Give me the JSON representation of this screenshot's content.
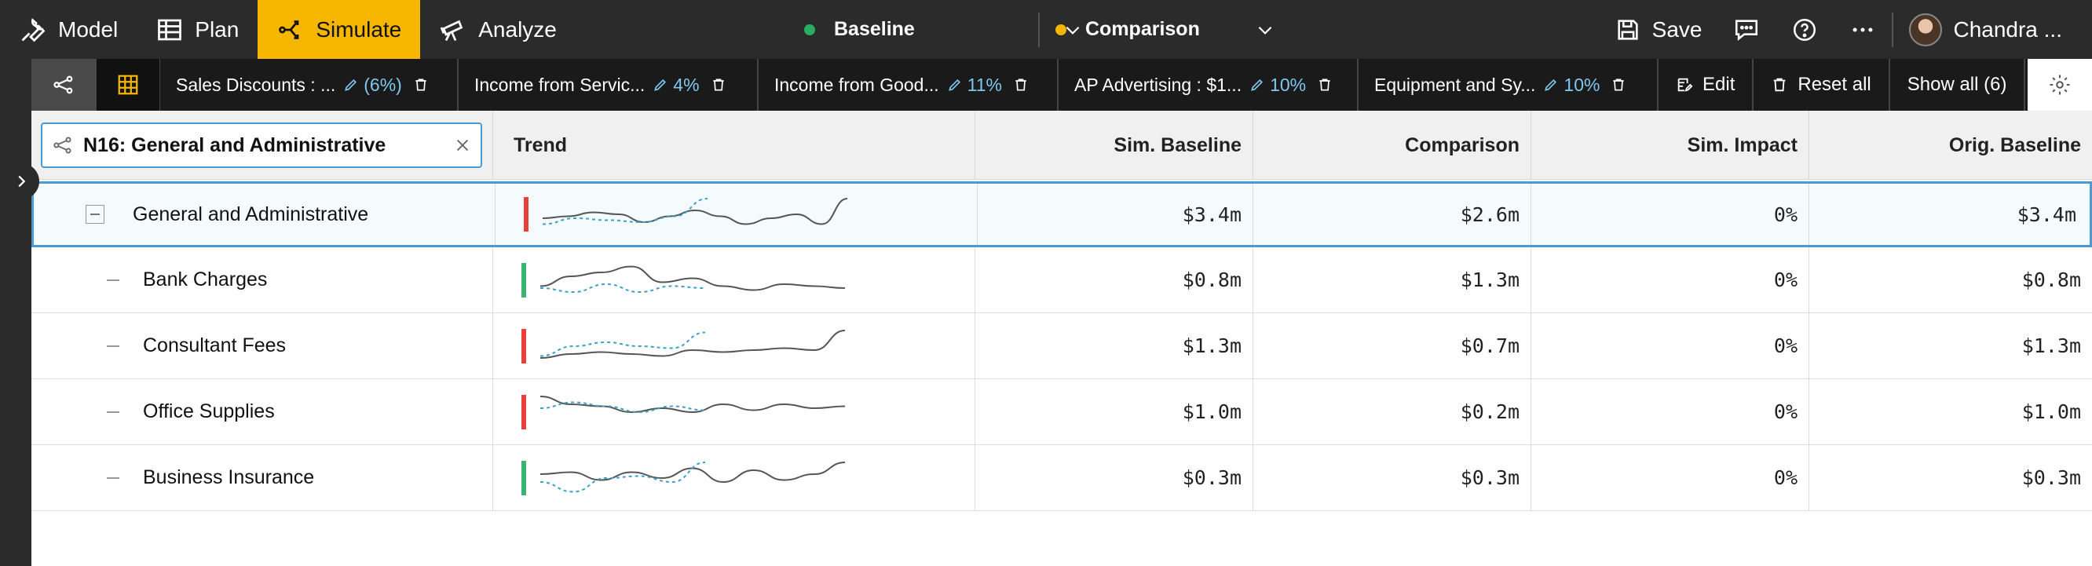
{
  "nav": {
    "model": "Model",
    "plan": "Plan",
    "simulate": "Simulate",
    "analyze": "Analyze"
  },
  "scenarios": {
    "baseline": {
      "label": "Baseline",
      "color": "#27ae60"
    },
    "comparison": {
      "label": "Comparison",
      "color": "#f6b600"
    }
  },
  "tools": {
    "save": "Save",
    "user": "Chandra ..."
  },
  "chips": [
    {
      "label": "Sales Discounts : ...",
      "pct": "(6%)"
    },
    {
      "label": "Income from Servic...",
      "pct": "4%"
    },
    {
      "label": "Income from Good...",
      "pct": "11%"
    },
    {
      "label": "AP Advertising : $1...",
      "pct": "10%"
    },
    {
      "label": "Equipment and Sy...",
      "pct": "10%"
    }
  ],
  "actions": {
    "edit": "Edit",
    "reset": "Reset all",
    "show_all": "Show all (6)"
  },
  "table": {
    "search_value": "N16: General and Administrative",
    "headers": {
      "trend": "Trend",
      "sim_baseline": "Sim. Baseline",
      "comparison": "Comparison",
      "sim_impact": "Sim. Impact",
      "orig_baseline": "Orig. Baseline"
    },
    "rows": [
      {
        "name": "General and Administrative",
        "bar_color": "#e8413c",
        "sim_baseline": "$3.4m",
        "comparison": "$2.6m",
        "sim_impact": "0%",
        "orig_baseline": "$3.4m",
        "selected": true,
        "parent": true,
        "solid": [
          0.6,
          0.55,
          0.45,
          0.5,
          0.7,
          0.55,
          0.4,
          0.55,
          0.75,
          0.6,
          0.5,
          0.75,
          0.1
        ],
        "dotted": [
          0.75,
          0.6,
          0.65,
          0.7,
          0.55,
          0.1
        ]
      },
      {
        "name": "Bank Charges",
        "bar_color": "#3cb371",
        "sim_baseline": "$0.8m",
        "comparison": "$1.3m",
        "sim_impact": "0%",
        "orig_baseline": "$0.8m",
        "selected": false,
        "parent": false,
        "solid": [
          0.65,
          0.4,
          0.3,
          0.15,
          0.55,
          0.45,
          0.65,
          0.75,
          0.6,
          0.65,
          0.7
        ],
        "dotted": [
          0.7,
          0.8,
          0.6,
          0.8,
          0.65,
          0.7
        ]
      },
      {
        "name": "Consultant Fees",
        "bar_color": "#e8413c",
        "sim_baseline": "$1.3m",
        "comparison": "$0.7m",
        "sim_impact": "0%",
        "orig_baseline": "$1.3m",
        "selected": false,
        "parent": false,
        "solid": [
          0.8,
          0.7,
          0.65,
          0.7,
          0.75,
          0.6,
          0.65,
          0.6,
          0.55,
          0.6,
          0.1
        ],
        "dotted": [
          0.75,
          0.5,
          0.4,
          0.5,
          0.55,
          0.15
        ]
      },
      {
        "name": "Office Supplies",
        "bar_color": "#e8413c",
        "sim_baseline": "$1.0m",
        "comparison": "$0.2m",
        "sim_impact": "0%",
        "orig_baseline": "$1.0m",
        "selected": false,
        "parent": false,
        "solid": [
          0.1,
          0.3,
          0.35,
          0.5,
          0.4,
          0.5,
          0.3,
          0.45,
          0.3,
          0.4,
          0.35
        ],
        "dotted": [
          0.4,
          0.25,
          0.35,
          0.5,
          0.35,
          0.45
        ]
      },
      {
        "name": "Business Insurance",
        "bar_color": "#3cb371",
        "sim_baseline": "$0.3m",
        "comparison": "$0.3m",
        "sim_impact": "0%",
        "orig_baseline": "$0.3m",
        "selected": false,
        "parent": false,
        "solid": [
          0.4,
          0.35,
          0.55,
          0.35,
          0.5,
          0.25,
          0.6,
          0.3,
          0.55,
          0.4,
          0.1
        ],
        "dotted": [
          0.6,
          0.85,
          0.5,
          0.45,
          0.6,
          0.1
        ]
      }
    ]
  }
}
